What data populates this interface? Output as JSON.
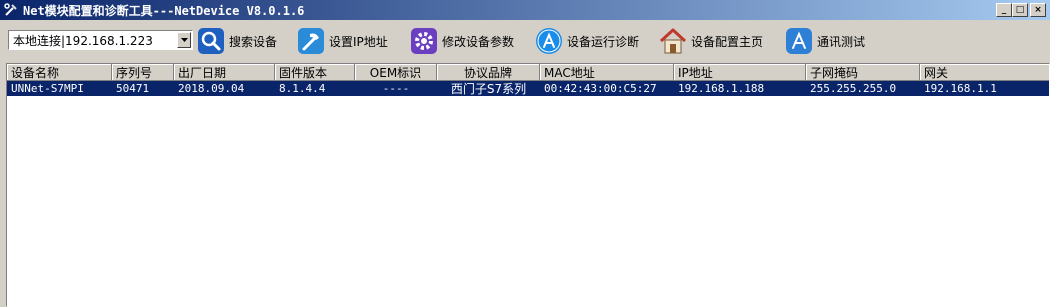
{
  "window": {
    "title": "Net模块配置和诊断工具---NetDevice V8.0.1.6",
    "controls": {
      "minimize": "_",
      "restore": "□",
      "close": "×"
    }
  },
  "toolbar": {
    "connection_select": {
      "value": "本地连接|192.168.1.223"
    },
    "buttons": [
      {
        "label": "搜索设备",
        "icon": "search-icon",
        "color": "#1f5fbf"
      },
      {
        "label": "设置IP地址",
        "icon": "hammer-icon",
        "color": "#2a8bd8"
      },
      {
        "label": "修改设备参数",
        "icon": "gear-icon",
        "color": "#6a3fc0"
      },
      {
        "label": "设备运行诊断",
        "icon": "appstore-icon",
        "color": "#1b8ce8"
      },
      {
        "label": "设备配置主页",
        "icon": "home-icon",
        "color": "#c0392b"
      },
      {
        "label": "通讯测试",
        "icon": "appstore-icon",
        "color": "#2e7fd6"
      }
    ]
  },
  "table": {
    "columns": [
      "设备名称",
      "序列号",
      "出厂日期",
      "固件版本",
      "OEM标识",
      "协议品牌",
      "MAC地址",
      "IP地址",
      "子网掩码",
      "网关"
    ],
    "rows": [
      [
        "UNNet-S7MPI",
        "50471",
        "2018.09.04",
        "8.1.4.4",
        "----",
        "西门子S7系列",
        "00:42:43:00:C5:27",
        "192.168.1.188",
        "255.255.255.0",
        "192.168.1.1"
      ]
    ],
    "selected_row_color": "#0a246a"
  }
}
